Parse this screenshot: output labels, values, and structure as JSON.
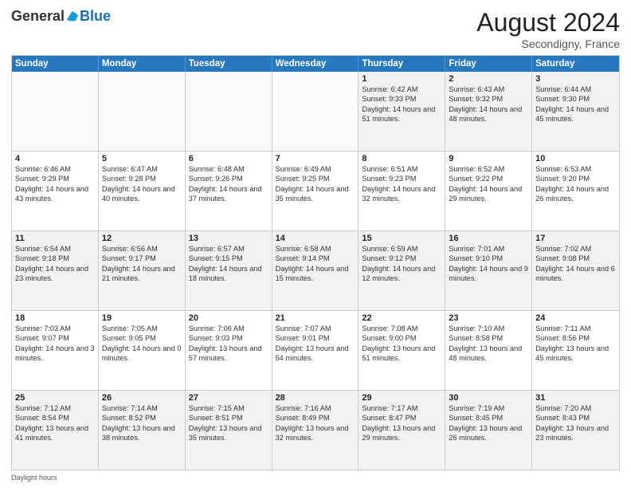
{
  "header": {
    "logo_general": "General",
    "logo_blue": "Blue",
    "month_title": "August 2024",
    "subtitle": "Secondigny, France"
  },
  "days_of_week": [
    "Sunday",
    "Monday",
    "Tuesday",
    "Wednesday",
    "Thursday",
    "Friday",
    "Saturday"
  ],
  "weeks": [
    [
      {
        "day": "",
        "sunrise": "",
        "sunset": "",
        "daylight": "",
        "empty": true
      },
      {
        "day": "",
        "sunrise": "",
        "sunset": "",
        "daylight": "",
        "empty": true
      },
      {
        "day": "",
        "sunrise": "",
        "sunset": "",
        "daylight": "",
        "empty": true
      },
      {
        "day": "",
        "sunrise": "",
        "sunset": "",
        "daylight": "",
        "empty": true
      },
      {
        "day": "1",
        "sunrise": "Sunrise: 6:42 AM",
        "sunset": "Sunset: 9:33 PM",
        "daylight": "Daylight: 14 hours and 51 minutes."
      },
      {
        "day": "2",
        "sunrise": "Sunrise: 6:43 AM",
        "sunset": "Sunset: 9:32 PM",
        "daylight": "Daylight: 14 hours and 48 minutes."
      },
      {
        "day": "3",
        "sunrise": "Sunrise: 6:44 AM",
        "sunset": "Sunset: 9:30 PM",
        "daylight": "Daylight: 14 hours and 45 minutes."
      }
    ],
    [
      {
        "day": "4",
        "sunrise": "Sunrise: 6:46 AM",
        "sunset": "Sunset: 9:29 PM",
        "daylight": "Daylight: 14 hours and 43 minutes."
      },
      {
        "day": "5",
        "sunrise": "Sunrise: 6:47 AM",
        "sunset": "Sunset: 9:28 PM",
        "daylight": "Daylight: 14 hours and 40 minutes."
      },
      {
        "day": "6",
        "sunrise": "Sunrise: 6:48 AM",
        "sunset": "Sunset: 9:26 PM",
        "daylight": "Daylight: 14 hours and 37 minutes."
      },
      {
        "day": "7",
        "sunrise": "Sunrise: 6:49 AM",
        "sunset": "Sunset: 9:25 PM",
        "daylight": "Daylight: 14 hours and 35 minutes."
      },
      {
        "day": "8",
        "sunrise": "Sunrise: 6:51 AM",
        "sunset": "Sunset: 9:23 PM",
        "daylight": "Daylight: 14 hours and 32 minutes."
      },
      {
        "day": "9",
        "sunrise": "Sunrise: 6:52 AM",
        "sunset": "Sunset: 9:22 PM",
        "daylight": "Daylight: 14 hours and 29 minutes."
      },
      {
        "day": "10",
        "sunrise": "Sunrise: 6:53 AM",
        "sunset": "Sunset: 9:20 PM",
        "daylight": "Daylight: 14 hours and 26 minutes."
      }
    ],
    [
      {
        "day": "11",
        "sunrise": "Sunrise: 6:54 AM",
        "sunset": "Sunset: 9:18 PM",
        "daylight": "Daylight: 14 hours and 23 minutes."
      },
      {
        "day": "12",
        "sunrise": "Sunrise: 6:56 AM",
        "sunset": "Sunset: 9:17 PM",
        "daylight": "Daylight: 14 hours and 21 minutes."
      },
      {
        "day": "13",
        "sunrise": "Sunrise: 6:57 AM",
        "sunset": "Sunset: 9:15 PM",
        "daylight": "Daylight: 14 hours and 18 minutes."
      },
      {
        "day": "14",
        "sunrise": "Sunrise: 6:58 AM",
        "sunset": "Sunset: 9:14 PM",
        "daylight": "Daylight: 14 hours and 15 minutes."
      },
      {
        "day": "15",
        "sunrise": "Sunrise: 6:59 AM",
        "sunset": "Sunset: 9:12 PM",
        "daylight": "Daylight: 14 hours and 12 minutes."
      },
      {
        "day": "16",
        "sunrise": "Sunrise: 7:01 AM",
        "sunset": "Sunset: 9:10 PM",
        "daylight": "Daylight: 14 hours and 9 minutes."
      },
      {
        "day": "17",
        "sunrise": "Sunrise: 7:02 AM",
        "sunset": "Sunset: 9:08 PM",
        "daylight": "Daylight: 14 hours and 6 minutes."
      }
    ],
    [
      {
        "day": "18",
        "sunrise": "Sunrise: 7:03 AM",
        "sunset": "Sunset: 9:07 PM",
        "daylight": "Daylight: 14 hours and 3 minutes."
      },
      {
        "day": "19",
        "sunrise": "Sunrise: 7:05 AM",
        "sunset": "Sunset: 9:05 PM",
        "daylight": "Daylight: 14 hours and 0 minutes."
      },
      {
        "day": "20",
        "sunrise": "Sunrise: 7:06 AM",
        "sunset": "Sunset: 9:03 PM",
        "daylight": "Daylight: 13 hours and 57 minutes."
      },
      {
        "day": "21",
        "sunrise": "Sunrise: 7:07 AM",
        "sunset": "Sunset: 9:01 PM",
        "daylight": "Daylight: 13 hours and 54 minutes."
      },
      {
        "day": "22",
        "sunrise": "Sunrise: 7:08 AM",
        "sunset": "Sunset: 9:00 PM",
        "daylight": "Daylight: 13 hours and 51 minutes."
      },
      {
        "day": "23",
        "sunrise": "Sunrise: 7:10 AM",
        "sunset": "Sunset: 8:58 PM",
        "daylight": "Daylight: 13 hours and 48 minutes."
      },
      {
        "day": "24",
        "sunrise": "Sunrise: 7:11 AM",
        "sunset": "Sunset: 8:56 PM",
        "daylight": "Daylight: 13 hours and 45 minutes."
      }
    ],
    [
      {
        "day": "25",
        "sunrise": "Sunrise: 7:12 AM",
        "sunset": "Sunset: 8:54 PM",
        "daylight": "Daylight: 13 hours and 41 minutes."
      },
      {
        "day": "26",
        "sunrise": "Sunrise: 7:14 AM",
        "sunset": "Sunset: 8:52 PM",
        "daylight": "Daylight: 13 hours and 38 minutes."
      },
      {
        "day": "27",
        "sunrise": "Sunrise: 7:15 AM",
        "sunset": "Sunset: 8:51 PM",
        "daylight": "Daylight: 13 hours and 35 minutes."
      },
      {
        "day": "28",
        "sunrise": "Sunrise: 7:16 AM",
        "sunset": "Sunset: 8:49 PM",
        "daylight": "Daylight: 13 hours and 32 minutes."
      },
      {
        "day": "29",
        "sunrise": "Sunrise: 7:17 AM",
        "sunset": "Sunset: 8:47 PM",
        "daylight": "Daylight: 13 hours and 29 minutes."
      },
      {
        "day": "30",
        "sunrise": "Sunrise: 7:19 AM",
        "sunset": "Sunset: 8:45 PM",
        "daylight": "Daylight: 13 hours and 26 minutes."
      },
      {
        "day": "31",
        "sunrise": "Sunrise: 7:20 AM",
        "sunset": "Sunset: 8:43 PM",
        "daylight": "Daylight: 13 hours and 23 minutes."
      }
    ]
  ],
  "footer": {
    "label": "Daylight hours"
  }
}
